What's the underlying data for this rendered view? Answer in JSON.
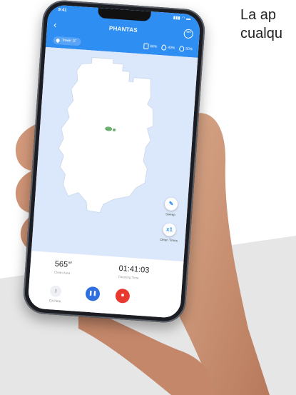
{
  "caption": {
    "line1": "La ap",
    "line2": "cualqu"
  },
  "status_bar": {
    "time": "9:41",
    "icons": "▮▮▮ ◠ ▬"
  },
  "header": {
    "title": "PHANTAS",
    "floor": "Tower 1F"
  },
  "stats": [
    {
      "icon": "battery-icon",
      "value": "66%"
    },
    {
      "icon": "water-drop-icon",
      "value": "40%"
    },
    {
      "icon": "dust-drop-icon",
      "value": "50%"
    }
  ],
  "map": {
    "actions": [
      {
        "label": "Sweep",
        "icon": "broom-icon",
        "glyph": "✎"
      },
      {
        "label": "Clean Times",
        "icon": "times-icon",
        "glyph": "x1"
      }
    ]
  },
  "panel": {
    "clean_area_value": "565",
    "clean_area_unit": "m²",
    "clean_area_label": "Clean Area",
    "cleaning_time_value": "01:41:03",
    "cleaning_time_label": "Cleaning Time",
    "go_here_label": "Go here"
  },
  "colors": {
    "accent": "#2e8ef2",
    "pause": "#2f6fe0",
    "stop": "#e8392f"
  }
}
